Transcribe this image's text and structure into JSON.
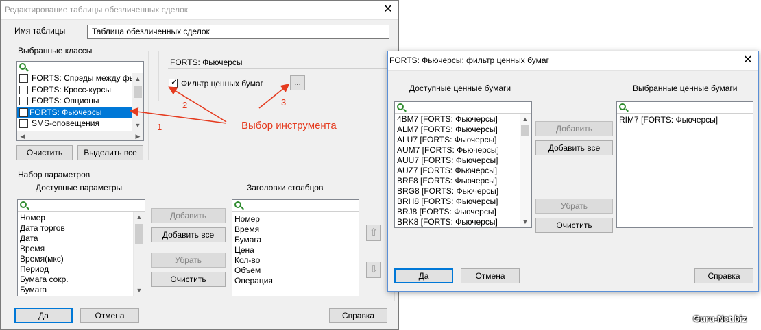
{
  "main_window": {
    "title": "Редактирование таблицы обезличенных сделок",
    "table_name_label": "Имя таблицы",
    "table_name_value": "Таблица обезличенных сделок",
    "classes_group": "Выбранные классы",
    "classes": [
      {
        "label": "FORTS: Спрэды между фью",
        "checked": false
      },
      {
        "label": "FORTS: Кросс-курсы",
        "checked": false
      },
      {
        "label": "FORTS: Опционы",
        "checked": false
      },
      {
        "label": "FORTS: Фьючерсы",
        "checked": true
      },
      {
        "label": "SMS-оповещения",
        "checked": false
      }
    ],
    "clear_button": "Очистить",
    "select_all_button": "Выделить все",
    "selected_class_field": "FORTS: Фьючерсы",
    "security_filter_label": "Фильтр ценных бумаг",
    "security_filter_checked": true,
    "ellipsis_button": "...",
    "params_group": "Набор параметров",
    "available_params_title": "Доступные параметры",
    "available_params": [
      "Номер",
      "Дата торгов",
      "Дата",
      "Время",
      "Время(мкс)",
      "Период",
      "Бумага сокр.",
      "Бумага"
    ],
    "column_headers_title": "Заголовки столбцов",
    "column_headers": [
      "Номер",
      "Время",
      "Бумага",
      "Цена",
      "Кол-во",
      "Объем",
      "Операция"
    ],
    "add_button": "Добавить",
    "add_all_button": "Добавить все",
    "remove_button": "Убрать",
    "clear2_button": "Очистить",
    "ok_button": "Да",
    "cancel_button": "Отмена",
    "help_button": "Справка"
  },
  "filter_dialog": {
    "title": "FORTS: Фьючерсы: фильтр ценных бумаг",
    "available_title": "Доступные ценные бумаги",
    "selected_title": "Выбранные ценные бумаги",
    "available_items": [
      "4BM7 [FORTS: Фьючерсы]",
      "ALM7 [FORTS: Фьючерсы]",
      "ALU7 [FORTS: Фьючерсы]",
      "AUM7 [FORTS: Фьючерсы]",
      "AUU7 [FORTS: Фьючерсы]",
      "AUZ7 [FORTS: Фьючерсы]",
      "BRF8 [FORTS: Фьючерсы]",
      "BRG8 [FORTS: Фьючерсы]",
      "BRH8 [FORTS: Фьючерсы]",
      "BRJ8 [FORTS: Фьючерсы]",
      "BRK8 [FORTS: Фьючерсы]"
    ],
    "selected_items": [
      "RIM7 [FORTS: Фьючерсы]"
    ],
    "add_button": "Добавить",
    "add_all_button": "Добавить все",
    "remove_button": "Убрать",
    "clear_button": "Очистить",
    "ok_button": "Да",
    "cancel_button": "Отмена",
    "help_button": "Справка"
  },
  "annotations": {
    "label": "Выбор инструмента",
    "n1": "1",
    "n2": "2",
    "n3": "3"
  },
  "watermark": "Guru-Net.biz",
  "colors": {
    "accent": "#0078d7",
    "annotation": "#e53b1f"
  }
}
